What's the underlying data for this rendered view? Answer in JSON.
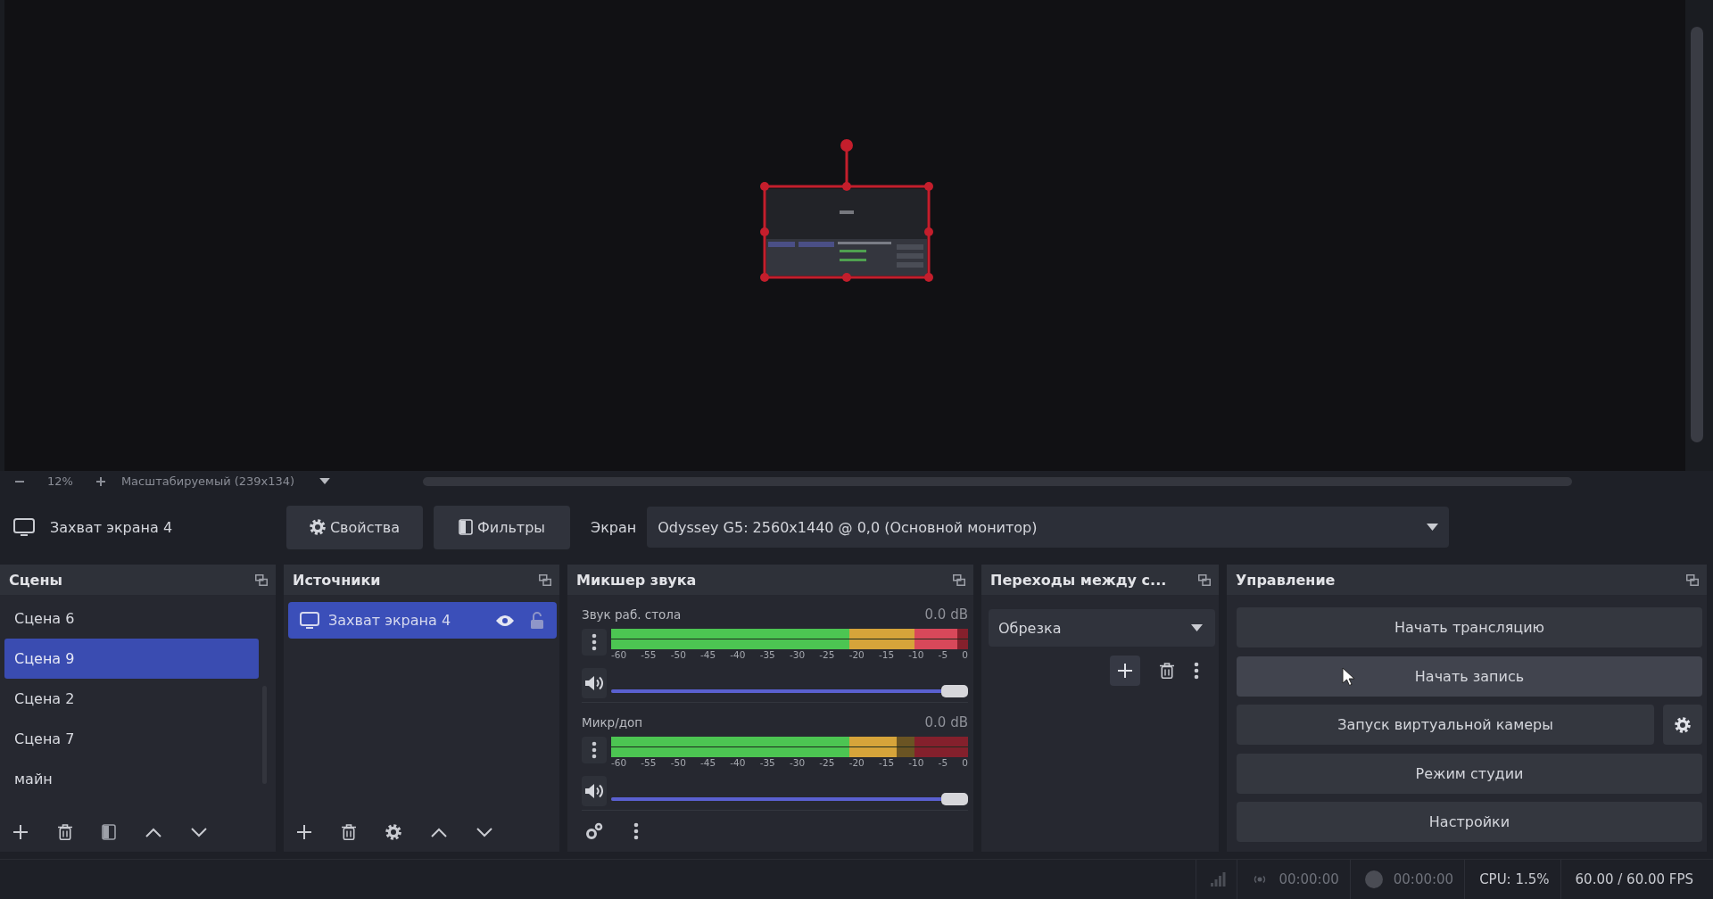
{
  "preview": {
    "zoom": "12%",
    "scale_mode": "Масштабируемый (239x134)"
  },
  "source_toolbar": {
    "source_name": "Захват экрана 4",
    "buttons": [
      {
        "kind": "properties",
        "label": "Свойства"
      },
      {
        "kind": "filters",
        "label": "Фильтры"
      }
    ],
    "display": {
      "label": "Экран",
      "value": "Odyssey G5: 2560x1440 @ 0,0 (Основной монитор)"
    }
  },
  "scenes": {
    "title": "Сцены",
    "items": [
      {
        "name": "Сцена 6",
        "selected": false
      },
      {
        "name": "Сцена 9",
        "selected": true
      },
      {
        "name": "Сцена 2",
        "selected": false
      },
      {
        "name": "Сцена 7",
        "selected": false
      },
      {
        "name": "майн",
        "selected": false
      }
    ]
  },
  "sources": {
    "title": "Источники",
    "items": [
      {
        "name": "Захват экрана 4",
        "selected": true,
        "visible": true,
        "locked": false
      }
    ]
  },
  "mixer": {
    "title": "Микшер звука",
    "channels": [
      {
        "name": "Звук раб. стола",
        "reading": "0.0 dB",
        "muted": false,
        "meter": {
          "level": 0.97,
          "ticks": [
            "-60",
            "-55",
            "-50",
            "-45",
            "-40",
            "-35",
            "-30",
            "-25",
            "-20",
            "-15",
            "-10",
            "-5",
            "0"
          ]
        },
        "volume": {
          "level": 1
        }
      },
      {
        "name": "Микр/доп",
        "reading": "0.0 dB",
        "muted": false,
        "meter": {
          "level": 0.8,
          "ticks": [
            "-60",
            "-55",
            "-50",
            "-45",
            "-40",
            "-35",
            "-30",
            "-25",
            "-20",
            "-15",
            "-10",
            "-5",
            "0"
          ]
        },
        "volume": {
          "level": 1
        }
      }
    ]
  },
  "transitions": {
    "title": "Переходы между с...",
    "value": "Обрезка"
  },
  "controls": {
    "title": "Управление",
    "buttons": [
      {
        "label": "Начать трансляцию",
        "hovered": false,
        "settings": false
      },
      {
        "label": "Начать запись",
        "hovered": true,
        "settings": false
      },
      {
        "label": "Запуск виртуальной камеры",
        "hovered": false,
        "settings": true
      },
      {
        "label": "Режим студии",
        "hovered": false,
        "settings": false
      },
      {
        "label": "Настройки",
        "hovered": false,
        "settings": false
      }
    ]
  },
  "status_bar": {
    "stream_time": "00:00:00",
    "record_time": "00:00:00",
    "cpu": "CPU: 1.5%",
    "fps": "60.00 / 60.00 FPS"
  }
}
